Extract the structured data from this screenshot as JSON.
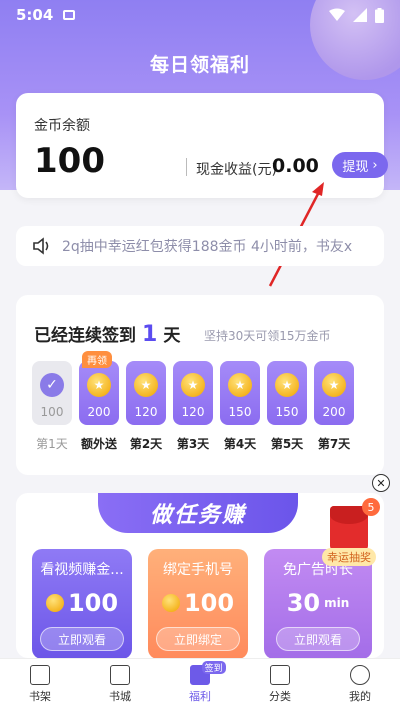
{
  "status_bar": {
    "time": "5:04"
  },
  "header": {
    "title": "每日领福利"
  },
  "balance": {
    "label": "金币余额",
    "value": "100",
    "cash_label": "现金收益(元)",
    "cash_value": "0.00",
    "withdraw_label": "提现"
  },
  "notice": {
    "text": "2q抽中幸运红包获得188金币 4小时前，书友x"
  },
  "checkin": {
    "title_prefix": "已经连续签到",
    "days": "1",
    "title_suffix": "天",
    "hint": "坚持30天可领15万金币",
    "double_badge": "再领",
    "items": [
      {
        "amount": "100",
        "label": "第1天"
      },
      {
        "amount": "200",
        "label": "额外送"
      },
      {
        "amount": "120",
        "label": "第2天"
      },
      {
        "amount": "120",
        "label": "第3天"
      },
      {
        "amount": "150",
        "label": "第4天"
      },
      {
        "amount": "150",
        "label": "第5天"
      },
      {
        "amount": "200",
        "label": "第7天"
      }
    ]
  },
  "tasks": {
    "banner": "做任务赚",
    "items": [
      {
        "title": "看视频赚金...",
        "amount": "100",
        "unit": "",
        "button": "立即观看"
      },
      {
        "title": "绑定手机号",
        "amount": "100",
        "unit": "",
        "button": "立即绑定"
      },
      {
        "title": "免广告时长",
        "amount": "30",
        "unit": "min",
        "button": "立即观看"
      }
    ]
  },
  "lucky": {
    "badge": "5",
    "label": "幸运抽奖"
  },
  "tabbar": {
    "items": [
      "书架",
      "书城",
      "福利",
      "分类",
      "我的"
    ],
    "active_badge": "签到"
  },
  "colors": {
    "accent": "#7b68ee",
    "orange": "#ff8a5c",
    "coin": "#f4b21c"
  }
}
